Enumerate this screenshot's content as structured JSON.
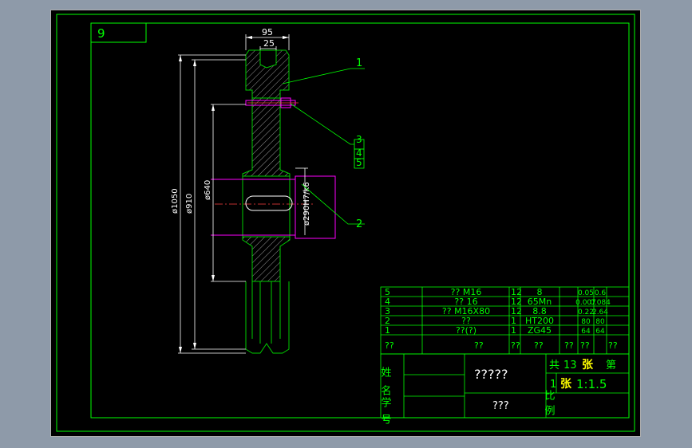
{
  "sheet_number": "9",
  "dimensions": {
    "top_width": "95",
    "slot_width": "25",
    "outer_dia": "ø1050",
    "pitch_dia": "ø910",
    "inner_dia": "ø640",
    "bore": "ø290H7/k6"
  },
  "balloons": [
    "1",
    "2",
    "3",
    "4",
    "5"
  ],
  "parts_list": {
    "rows": [
      {
        "no": "5",
        "name": "?? M16",
        "qty": "12",
        "material": "8",
        "unit_wt": "0.05",
        "total_wt": "0.6"
      },
      {
        "no": "4",
        "name": "?? 16",
        "qty": "12",
        "material": "65Mn",
        "unit_wt": "0.007",
        "total_wt": "0.084"
      },
      {
        "no": "3",
        "name": "?? M16X80",
        "qty": "12",
        "material": "8.8",
        "unit_wt": "0.22",
        "total_wt": "2.64"
      },
      {
        "no": "2",
        "name": "??",
        "qty": "1",
        "material": "HT200",
        "unit_wt": "80",
        "total_wt": "80"
      },
      {
        "no": "1",
        "name": "??(?)",
        "qty": "1",
        "material": "ZG45",
        "unit_wt": "64",
        "total_wt": "64"
      }
    ],
    "header": {
      "no": "??",
      "name": "??",
      "qty": "??",
      "material": "??",
      "unit_wt": "??",
      "total_wt": "??",
      "remark": "??"
    }
  },
  "title_block": {
    "name_label": "姓名",
    "id_label": "学号",
    "drawing_name": "?????",
    "school": "???",
    "sheets_total_label": "共",
    "sheets_total": "13",
    "sheet_unit": "张",
    "sheet_no_label": "第",
    "sheet_no": "1",
    "sheet_unit2": "张",
    "scale_label": "比例",
    "scale_value": "1:1.5"
  },
  "colors": {
    "background": "#000000",
    "outline": "#00ff00",
    "part_line": "#00cc00",
    "dimension": "#ffffff",
    "magenta": "#ff00ff",
    "hatch": "#a0a0a0",
    "table_text": "#00ff00",
    "title_yellow": "#ffff00",
    "centerline": "#ff4040"
  }
}
